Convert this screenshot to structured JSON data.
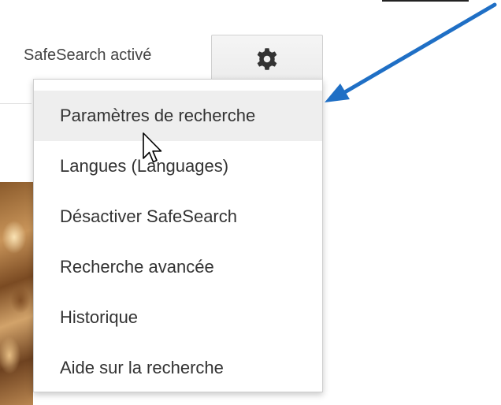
{
  "header": {
    "safesearch_status": "SafeSearch activé",
    "settings_icon": "gear-icon"
  },
  "settings_menu": {
    "items": [
      {
        "label": "Paramètres de recherche",
        "state": "hovered"
      },
      {
        "label": "Langues  (Languages)"
      },
      {
        "label": "Désactiver SafeSearch"
      },
      {
        "label": "Recherche avancée"
      },
      {
        "label": "Historique"
      },
      {
        "label": "Aide sur la recherche"
      }
    ]
  },
  "annotation": {
    "arrow_color": "#1f6fc5"
  },
  "colors": {
    "menu_hover": "#eeeeee",
    "menu_text": "#333333",
    "label_text": "#444444",
    "gear_icon": "#333333"
  }
}
